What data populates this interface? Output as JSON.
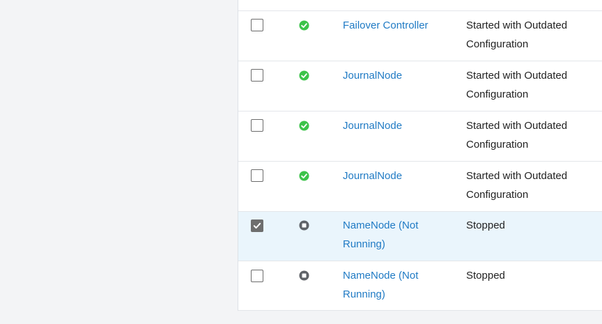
{
  "rows": [
    {
      "name": "Failover Controller",
      "state": "Started with Outdated Configuration",
      "status_icon": "check-circle-icon",
      "checked": false
    },
    {
      "name": "JournalNode",
      "state": "Started with Outdated Configuration",
      "status_icon": "check-circle-icon",
      "checked": false
    },
    {
      "name": "JournalNode",
      "state": "Started with Outdated Configuration",
      "status_icon": "check-circle-icon",
      "checked": false
    },
    {
      "name": "JournalNode",
      "state": "Started with Outdated Configuration",
      "status_icon": "check-circle-icon",
      "checked": false
    },
    {
      "name": "NameNode (Not Running)",
      "state": "Stopped",
      "status_icon": "stopped-circle-icon",
      "checked": true
    },
    {
      "name": "NameNode (Not Running)",
      "state": "Stopped",
      "status_icon": "stopped-circle-icon",
      "checked": false
    }
  ],
  "colors": {
    "link": "#1f7ac4",
    "ok": "#3cc34a",
    "stopped": "#5f6368",
    "selected_row": "#eaf5fc"
  }
}
